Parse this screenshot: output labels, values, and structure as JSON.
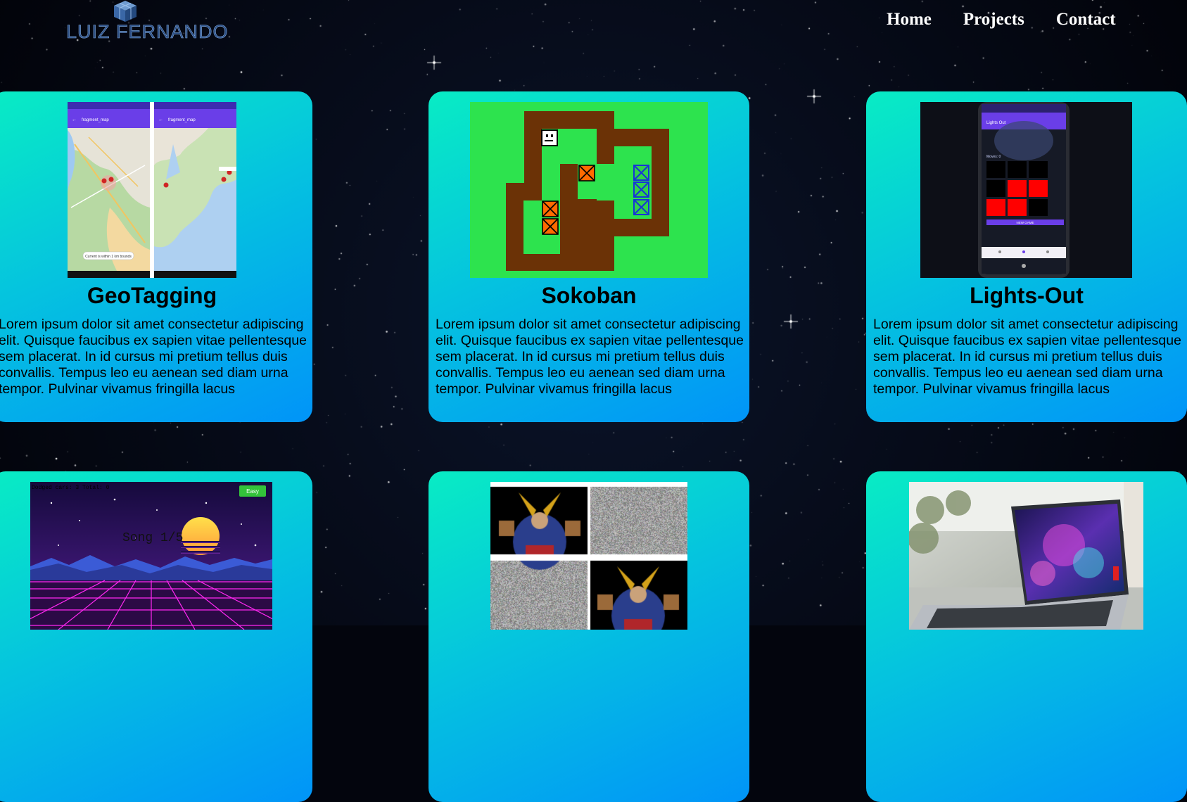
{
  "header": {
    "logo_text": "LUIZ FERNANDO",
    "nav": [
      "Home",
      "Projects",
      "Contact"
    ]
  },
  "projects": [
    {
      "title": "GeoTagging",
      "description": "Lorem ipsum dolor sit amet consectetur adipiscing elit. Quisque faucibus ex sapien vitae pellentesque sem placerat. In id cursus mi pretium tellus duis convallis. Tempus leo eu aenean sed diam urna tempor. Pulvinar vivamus fringilla lacus",
      "screens": [
        {
          "appbar": "fragment_map",
          "banner": "Current is within 1 km bounds"
        },
        {
          "appbar": "fragment_map"
        }
      ]
    },
    {
      "title": "Sokoban",
      "description": "Lorem ipsum dolor sit amet consectetur adipiscing elit. Quisque faucibus ex sapien vitae pellentesque sem placerat. In id cursus mi pretium tellus duis convallis. Tempus leo eu aenean sed diam urna tempor. Pulvinar vivamus fringilla lacus"
    },
    {
      "title": "Lights-Out",
      "description": "Lorem ipsum dolor sit amet consectetur adipiscing elit. Quisque faucibus ex sapien vitae pellentesque sem placerat. In id cursus mi pretium tellus duis convallis. Tempus leo eu aenean sed diam urna tempor. Pulvinar vivamus fringilla lacus",
      "phone": {
        "appbar": "Lights Out",
        "moves": "Moves: 0",
        "button": "NEW GAME"
      }
    },
    {
      "title": "",
      "game": {
        "hud": "Dodged cars: 3  Total: 0",
        "difficulty": "Easy",
        "song": "Song 1/5"
      }
    },
    {
      "title": ""
    },
    {
      "title": ""
    }
  ],
  "colors": {
    "card_gradient_start": "#08ecc4",
    "card_gradient_end": "#0194f8",
    "background": "#03050d",
    "logo": "#2c4f86"
  }
}
